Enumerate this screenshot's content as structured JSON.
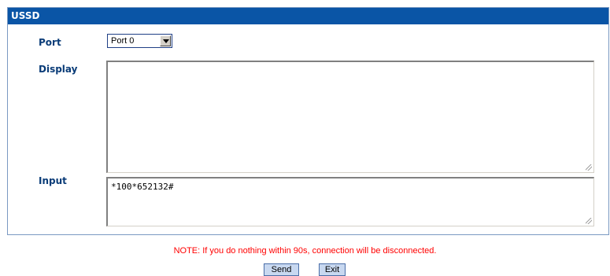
{
  "panel": {
    "title": "USSD"
  },
  "port": {
    "label": "Port",
    "selected": "Port 0"
  },
  "display": {
    "label": "Display",
    "value": ""
  },
  "input": {
    "label": "Input",
    "value": "*100*652132#"
  },
  "note": "NOTE: If you do nothing within 90s, connection will be disconnected.",
  "buttons": {
    "send": "Send",
    "exit": "Exit"
  },
  "colors": {
    "header_bg": "#0a55a6",
    "label_text": "#0a3c78",
    "note_text": "#ff0000",
    "button_bg": "#c8d8f0"
  }
}
